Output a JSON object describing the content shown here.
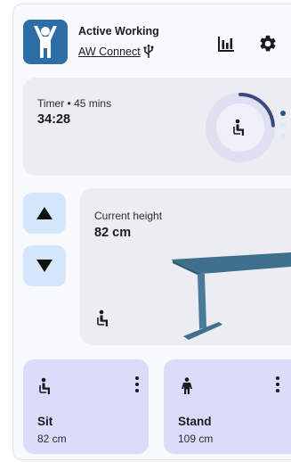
{
  "header": {
    "app_name": "Active Working",
    "connection_label": "AW Connect",
    "logo_icon": "person-arms-raised-icon",
    "usb_icon": "usb-icon",
    "stats_icon": "bar-chart-icon",
    "settings_icon": "gear-icon"
  },
  "timer": {
    "label": "Timer • 45 mins",
    "value": "34:28",
    "progress_fraction": 0.24,
    "mode_icon": "sitting-person-icon",
    "page_count": 3,
    "active_page": 0
  },
  "height": {
    "label": "Current height",
    "value": "82 cm",
    "up_icon": "triangle-up-icon",
    "down_icon": "triangle-down-icon",
    "mode_icon": "sitting-person-icon"
  },
  "presets": [
    {
      "name": "Sit",
      "height": "82 cm",
      "icon": "sitting-person-icon"
    },
    {
      "name": "Stand",
      "height": "109 cm",
      "icon": "standing-person-icon"
    }
  ],
  "colors": {
    "brand_blue": "#2d6ea7",
    "progress_arc": "#3c4a7a",
    "arrow_button": "#d4e7fa",
    "preset_card": "#dbdcfa",
    "card_bg": "#ebedf2",
    "desk": "#4a7a99"
  }
}
